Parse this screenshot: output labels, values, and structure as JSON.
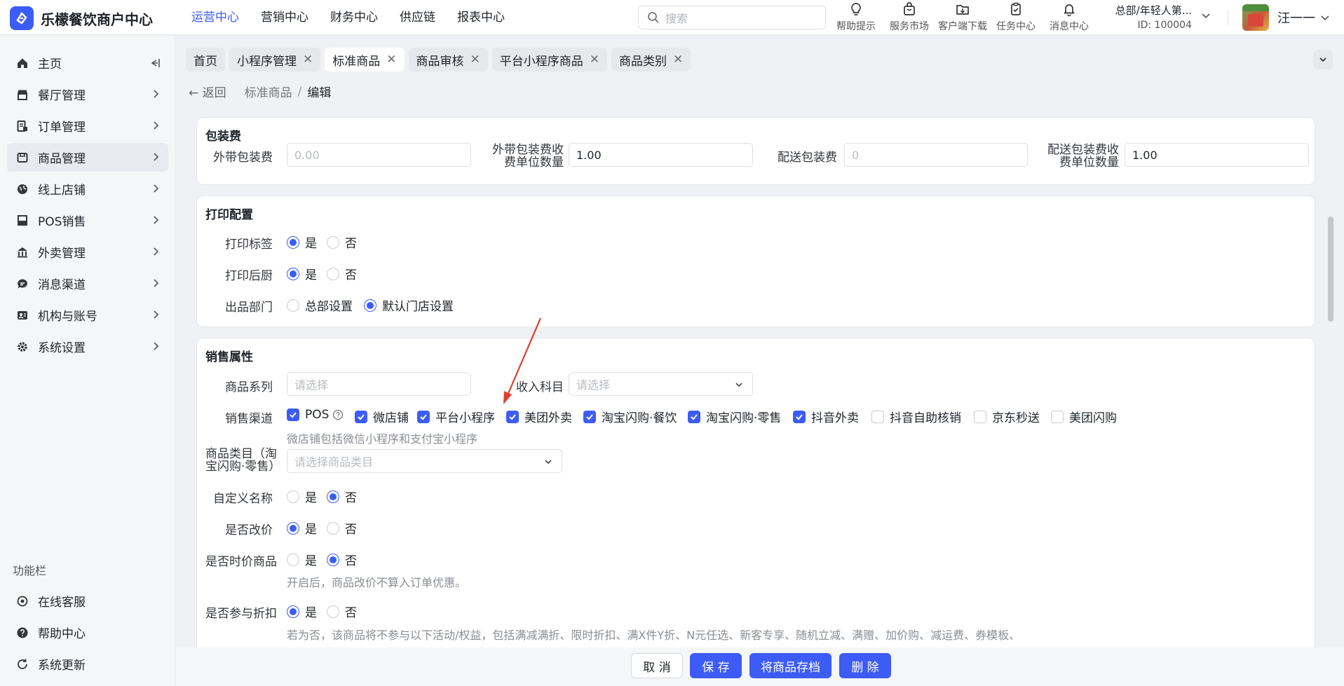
{
  "app": {
    "title": "乐檬餐饮商户中心",
    "brand_color": "#3d5cf5"
  },
  "topnav": {
    "items": [
      "运营中心",
      "营销中心",
      "财务中心",
      "供应链",
      "报表中心"
    ]
  },
  "search": {
    "placeholder": "搜索"
  },
  "tools": [
    {
      "label": "帮助提示",
      "icon": "lightbulb-icon"
    },
    {
      "label": "服务市场",
      "icon": "shop-bag-icon"
    },
    {
      "label": "客户端下载",
      "icon": "folder-download-icon"
    },
    {
      "label": "任务中心",
      "icon": "clipboard-check-icon"
    },
    {
      "label": "消息中心",
      "icon": "bell-icon"
    }
  ],
  "org": {
    "name": "总部/年轻人第...",
    "id": "ID: 100004"
  },
  "user": {
    "name": "汪一一"
  },
  "sidebar": {
    "items": [
      {
        "label": "主页",
        "icon": "home-icon"
      },
      {
        "label": "餐厅管理",
        "icon": "store-icon"
      },
      {
        "label": "订单管理",
        "icon": "order-icon"
      },
      {
        "label": "商品管理",
        "icon": "goods-icon"
      },
      {
        "label": "线上店铺",
        "icon": "globe-icon"
      },
      {
        "label": "POS销售",
        "icon": "pos-icon"
      },
      {
        "label": "外卖管理",
        "icon": "delivery-icon"
      },
      {
        "label": "消息渠道",
        "icon": "chat-icon"
      },
      {
        "label": "机构与账号",
        "icon": "account-icon"
      },
      {
        "label": "系统设置",
        "icon": "gear-icon"
      }
    ],
    "function_title": "功能栏",
    "functions": [
      {
        "label": "在线客服",
        "icon": "headset-icon"
      },
      {
        "label": "帮助中心",
        "icon": "help-circle-icon"
      },
      {
        "label": "系统更新",
        "icon": "refresh-icon"
      }
    ]
  },
  "tabs": [
    {
      "label": "首页",
      "closable": false
    },
    {
      "label": "小程序管理",
      "closable": true
    },
    {
      "label": "标准商品",
      "closable": true
    },
    {
      "label": "商品审核",
      "closable": true
    },
    {
      "label": "平台小程序商品",
      "closable": true
    },
    {
      "label": "商品类别",
      "closable": true
    }
  ],
  "breadcrumb": {
    "back": "返回",
    "parent": "标准商品",
    "current": "编辑"
  },
  "packaging": {
    "title": "包装费",
    "takeout_fee_label": "外带包装费",
    "takeout_fee_placeholder": "0.00",
    "takeout_unit_label": "外带包装费收费单位数量",
    "takeout_unit_value": "1.00",
    "delivery_fee_label": "配送包装费",
    "delivery_fee_placeholder": "0",
    "delivery_unit_label": "配送包装费收费单位数量",
    "delivery_unit_value": "1.00"
  },
  "print": {
    "title": "打印配置",
    "rows": [
      {
        "label": "打印标签",
        "options": [
          "是",
          "否"
        ],
        "selected": "是"
      },
      {
        "label": "打印后厨",
        "options": [
          "是",
          "否"
        ],
        "selected": "是"
      },
      {
        "label": "出品部门",
        "options": [
          "总部设置",
          "默认门店设置"
        ],
        "selected": "默认门店设置"
      }
    ]
  },
  "sales": {
    "title": "销售属性",
    "series_label": "商品系列",
    "series_placeholder": "请选择",
    "income_label": "收入科目",
    "income_placeholder": "请选择",
    "channel_label": "销售渠道",
    "channels": [
      {
        "label": "POS",
        "checked": true,
        "help": "?"
      },
      {
        "label": "微店铺",
        "checked": true
      },
      {
        "label": "平台小程序",
        "checked": true
      },
      {
        "label": "美团外卖",
        "checked": true
      },
      {
        "label": "淘宝闪购·餐饮",
        "checked": true
      },
      {
        "label": "淘宝闪购·零售",
        "checked": true
      },
      {
        "label": "抖音外卖",
        "checked": true
      },
      {
        "label": "抖音自助核销",
        "checked": false
      },
      {
        "label": "京东秒送",
        "checked": false
      },
      {
        "label": "美团闪购",
        "checked": false
      }
    ],
    "channel_hint": "微店铺包括微信小程序和支付宝小程序",
    "category_label": "商品类目（淘宝闪购·零售）",
    "category_placeholder": "请选择商品类目",
    "rows": [
      {
        "label": "自定义名称",
        "options": [
          "是",
          "否"
        ],
        "selected": "否"
      },
      {
        "label": "是否改价",
        "options": [
          "是",
          "否"
        ],
        "selected": "是"
      },
      {
        "label": "是否时价商品",
        "options": [
          "是",
          "否"
        ],
        "selected": "否"
      },
      {
        "label": "是否参与折扣",
        "options": [
          "是",
          "否"
        ],
        "selected": "是"
      }
    ],
    "timeprice_hint": "开启后，商品改价不算入订单优惠。",
    "discount_hint": "若为否，该商品将不参与以下活动/权益，包括满减满折、限时折扣、满X件Y折、N元任选、新客专享、随机立减、满赠、加价购、减运费、券模板、"
  },
  "footer": {
    "cancel": "取 消",
    "save": "保 存",
    "archive": "将商品存档",
    "delete": "删 除"
  },
  "annotation": {
    "color": "#e03c2c"
  }
}
